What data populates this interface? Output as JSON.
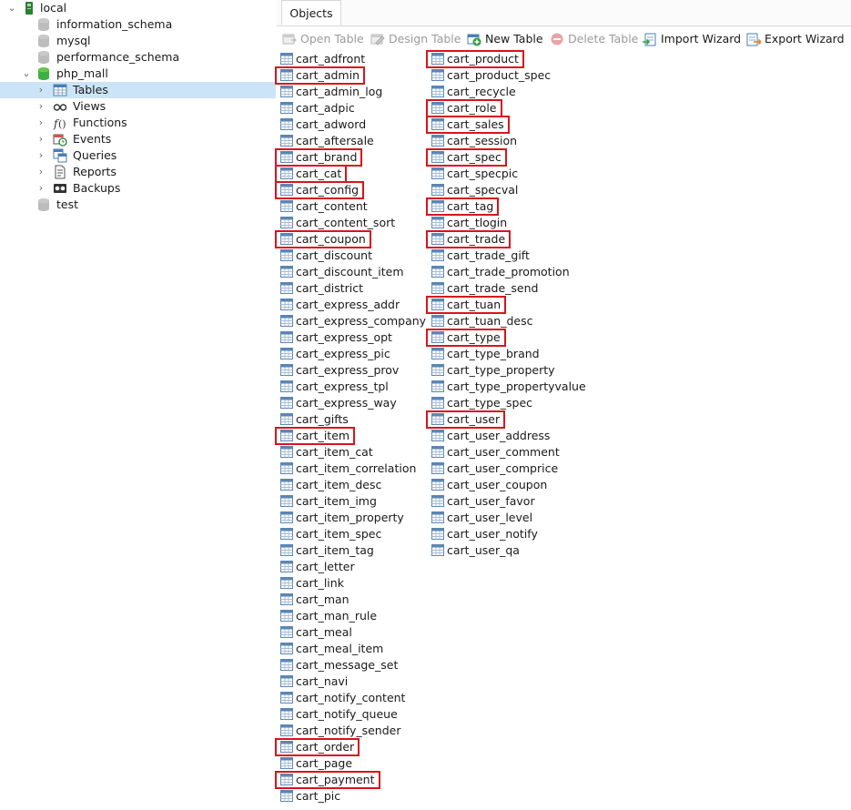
{
  "tree": {
    "connection": "local",
    "databases": [
      "information_schema",
      "mysql",
      "performance_schema",
      "php_mall",
      "test"
    ],
    "php_mall_children": [
      "Tables",
      "Views",
      "Functions",
      "Events",
      "Queries",
      "Reports",
      "Backups"
    ],
    "selected": "Tables"
  },
  "tab": {
    "label": "Objects"
  },
  "toolbar": {
    "open_table": "Open Table",
    "design_table": "Design Table",
    "new_table": "New Table",
    "delete_table": "Delete Table",
    "import_wizard": "Import Wizard",
    "export_wizard": "Export Wizard"
  },
  "tables_col1": [
    "cart_adfront",
    "cart_admin",
    "cart_admin_log",
    "cart_adpic",
    "cart_adword",
    "cart_aftersale",
    "cart_brand",
    "cart_cat",
    "cart_config",
    "cart_content",
    "cart_content_sort",
    "cart_coupon",
    "cart_discount",
    "cart_discount_item",
    "cart_district",
    "cart_express_addr",
    "cart_express_company",
    "cart_express_opt",
    "cart_express_pic",
    "cart_express_prov",
    "cart_express_tpl",
    "cart_express_way",
    "cart_gifts",
    "cart_item",
    "cart_item_cat",
    "cart_item_correlation",
    "cart_item_desc",
    "cart_item_img",
    "cart_item_property",
    "cart_item_spec",
    "cart_item_tag",
    "cart_letter",
    "cart_link",
    "cart_man",
    "cart_man_rule",
    "cart_meal",
    "cart_meal_item",
    "cart_message_set",
    "cart_navi",
    "cart_notify_content",
    "cart_notify_queue",
    "cart_notify_sender",
    "cart_order",
    "cart_page",
    "cart_payment",
    "cart_pic"
  ],
  "tables_col2": [
    "cart_product",
    "cart_product_spec",
    "cart_recycle",
    "cart_role",
    "cart_sales",
    "cart_session",
    "cart_spec",
    "cart_specpic",
    "cart_specval",
    "cart_tag",
    "cart_tlogin",
    "cart_trade",
    "cart_trade_gift",
    "cart_trade_promotion",
    "cart_trade_send",
    "cart_tuan",
    "cart_tuan_desc",
    "cart_type",
    "cart_type_brand",
    "cart_type_property",
    "cart_type_propertyvalue",
    "cart_type_spec",
    "cart_user",
    "cart_user_address",
    "cart_user_comment",
    "cart_user_comprice",
    "cart_user_coupon",
    "cart_user_favor",
    "cart_user_level",
    "cart_user_notify",
    "cart_user_qa"
  ],
  "highlighted": [
    "cart_admin",
    "cart_brand",
    "cart_cat",
    "cart_config",
    "cart_coupon",
    "cart_item",
    "cart_order",
    "cart_payment",
    "cart_product",
    "cart_role",
    "cart_sales",
    "cart_spec",
    "cart_tag",
    "cart_trade",
    "cart_tuan",
    "cart_type",
    "cart_user"
  ],
  "colors": {
    "selection": "#cce4f7",
    "highlight_border": "#d9141b",
    "db_active": "#3cb043",
    "db_inactive": "#c8c8c8"
  }
}
